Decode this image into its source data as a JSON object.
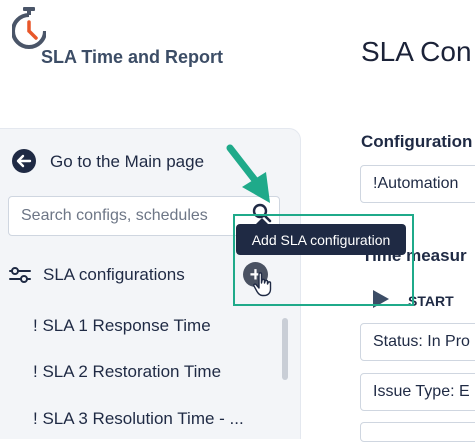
{
  "header": {
    "app_title": "SLA Time and Report",
    "page_title": "SLA Con"
  },
  "sidebar": {
    "back_label": "Go to the Main page",
    "search_placeholder": "Search configs, schedules",
    "configurations_label": "SLA configurations",
    "items": [
      "! SLA 1 Response Time",
      "! SLA 2 Restoration Time",
      "! SLA 3 Resolution Time - ..."
    ]
  },
  "tooltip": {
    "text": "Add SLA configuration"
  },
  "add_button": {
    "symbol": "+"
  },
  "main": {
    "configuration_label": "Configuration",
    "configuration_value": "!Automation",
    "time_measure_label": "Time measur",
    "start_label": "START",
    "conditions": [
      "Status: In Pro",
      "Issue Type: E"
    ]
  },
  "colors": {
    "accent_orange": "#e8572a",
    "logo_gray": "#4a5568",
    "highlight_green": "#1faa8a",
    "tooltip_bg": "#1f2a44",
    "sidebar_bg": "#f3f5f8"
  },
  "icons": [
    "stopwatch-logo-icon",
    "arrow-left-circle-icon",
    "search-icon",
    "sliders-icon",
    "plus-circle-icon",
    "hand-cursor-icon",
    "play-triangle-icon",
    "annotation-arrow-icon"
  ]
}
